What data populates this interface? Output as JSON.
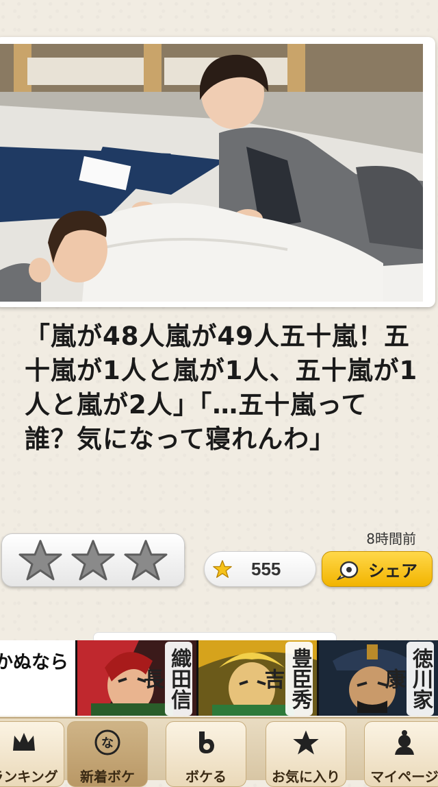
{
  "post": {
    "caption": "「嵐が48人嵐が49人五十嵐！五十嵐が1人と嵐が1人、五十嵐が1人と嵐が2人」「…五十嵐って誰？気になって寝れんわ」",
    "timestamp": "8時間前",
    "rating_stars": 3,
    "favorite_count": "555",
    "share_label": "シェア"
  },
  "banner": {
    "partial_text": "かぬなら うする？",
    "warlords": [
      {
        "name": "織田信長",
        "color": "#c0282e"
      },
      {
        "name": "豊臣秀吉",
        "color": "#d6a31c"
      },
      {
        "name": "徳川家康",
        "color": "#2a3b55"
      }
    ]
  },
  "tabs": [
    {
      "label": "ランキング",
      "icon": "crown-icon"
    },
    {
      "label": "新着ボケ",
      "icon": "new-icon",
      "active": true
    },
    {
      "label": "ボケる",
      "icon": "boke-icon"
    },
    {
      "label": "お気に入り",
      "icon": "star-icon"
    },
    {
      "label": "マイページ",
      "icon": "person-icon"
    }
  ]
}
